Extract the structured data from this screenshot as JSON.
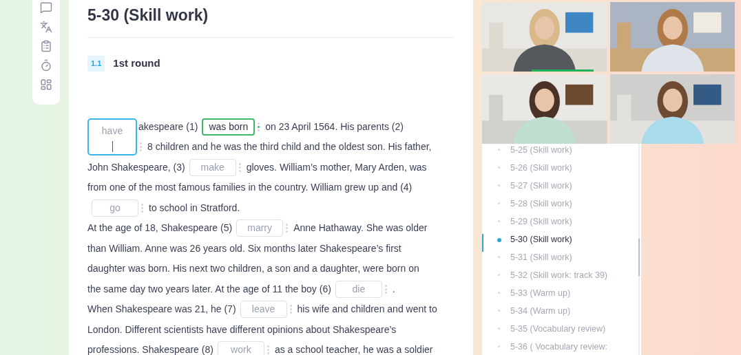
{
  "title": "5-30 (Skill work)",
  "section": {
    "number": "1.1",
    "title": "1st round"
  },
  "paragraph": [
    {
      "segments": [
        {
          "kind": "text",
          "text": "akespeare (1)"
        },
        {
          "kind": "gap",
          "answer": "was born",
          "correct": true,
          "active": false
        },
        {
          "kind": "text",
          "text": "on 23 April 1564. His parents (2)"
        }
      ]
    },
    {
      "segments": [
        {
          "kind": "gap",
          "hint": "have",
          "correct": false,
          "active": true
        },
        {
          "kind": "text",
          "text": "8 children and he was the third child and the oldest son. His father,"
        }
      ]
    },
    {
      "segments": [
        {
          "kind": "text",
          "text": "John Shakespeare, (3)"
        },
        {
          "kind": "gap",
          "hint": "make",
          "correct": false,
          "active": false
        },
        {
          "kind": "text",
          "text": "gloves. William’s mother, Mary Arden, was"
        }
      ]
    },
    {
      "segments": [
        {
          "kind": "text",
          "text": "from one of the most famous families in the country. William grew up and (4)"
        }
      ]
    },
    {
      "segments": [
        {
          "kind": "gap",
          "hint": "go",
          "correct": false,
          "active": false
        },
        {
          "kind": "text",
          "text": "to school in Stratford."
        }
      ]
    },
    {
      "segments": [
        {
          "kind": "text",
          "text": "At the age of 18, Shakespeare (5)"
        },
        {
          "kind": "gap",
          "hint": "marry",
          "correct": false,
          "active": false
        },
        {
          "kind": "text",
          "text": "Anne Hathaway. She was older"
        }
      ]
    },
    {
      "segments": [
        {
          "kind": "text",
          "text": "than William. Anne was 26 years old. Six months later Shakespeare’s first"
        }
      ]
    },
    {
      "segments": [
        {
          "kind": "text",
          "text": "daughter was born. His next two children, a son and a daughter, were born on"
        }
      ]
    },
    {
      "segments": [
        {
          "kind": "text",
          "text": "the same day two years later. At the age of 11 the boy (6)"
        },
        {
          "kind": "gap",
          "hint": "die",
          "correct": false,
          "active": false
        },
        {
          "kind": "text",
          "text": "."
        }
      ]
    },
    {
      "segments": [
        {
          "kind": "text",
          "text": "When Shakespeare was 21, he (7)"
        },
        {
          "kind": "gap",
          "hint": "leave",
          "correct": false,
          "active": false
        },
        {
          "kind": "text",
          "text": "his wife and children and went to"
        }
      ]
    },
    {
      "segments": [
        {
          "kind": "text",
          "text": "London. Different scientists have different opinions about Shakespeare’s"
        }
      ]
    },
    {
      "segments": [
        {
          "kind": "text",
          "text": "professions. Shakespeare (8)"
        },
        {
          "kind": "gap",
          "hint": "work",
          "correct": false,
          "active": false
        },
        {
          "kind": "text",
          "text": "as a school teacher, he was a soldier"
        }
      ]
    }
  ],
  "videos": [
    {
      "speaking": true
    },
    {
      "speaking": false
    },
    {
      "speaking": false
    },
    {
      "speaking": false
    }
  ],
  "lessons": [
    {
      "label": "5-25 (Skill work)",
      "selected": false
    },
    {
      "label": "5-26 (Skill work)",
      "selected": false
    },
    {
      "label": "5-27 (Skill work)",
      "selected": false
    },
    {
      "label": "5-28 (Skill work)",
      "selected": false
    },
    {
      "label": "5-29 (Skill work)",
      "selected": false
    },
    {
      "label": "5-30 (Skill work)",
      "selected": true
    },
    {
      "label": "5-31 (Skill work)",
      "selected": false
    },
    {
      "label": "5-32 (Skill work: track 39)",
      "selected": false
    },
    {
      "label": "5-33 (Warm up)",
      "selected": false
    },
    {
      "label": "5-34 (Warm up)",
      "selected": false
    },
    {
      "label": "5-35 (Vocabulary review)",
      "selected": false
    },
    {
      "label": "5-36 ( Vocabulary review:",
      "selected": false
    }
  ]
}
